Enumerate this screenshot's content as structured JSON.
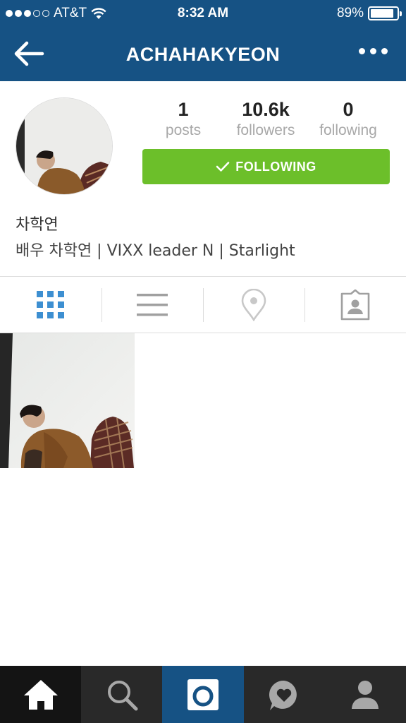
{
  "status_bar": {
    "carrier": "AT&T",
    "time": "8:32 AM",
    "battery": "89%",
    "battery_level": 0.89,
    "signal_dots_filled": 3,
    "signal_dots_total": 5
  },
  "nav": {
    "title": "ACHAHAKYEON",
    "back_icon": "arrow-left-icon",
    "more_icon": "more-dots-icon"
  },
  "profile": {
    "stats": [
      {
        "value": "1",
        "label": "posts"
      },
      {
        "value": "10.6k",
        "label": "followers"
      },
      {
        "value": "0",
        "label": "following"
      }
    ],
    "follow_button": "FOLLOWING",
    "name": "차학연",
    "bio": "배우 차학연 | VIXX leader N | Starlight"
  },
  "tabs": [
    {
      "icon": "grid-icon",
      "active": true
    },
    {
      "icon": "list-icon",
      "active": false
    },
    {
      "icon": "location-pin-icon",
      "active": false
    },
    {
      "icon": "tagged-photos-icon",
      "active": false
    }
  ],
  "posts_count": 1,
  "bottom_nav": [
    {
      "icon": "home-icon",
      "active": true
    },
    {
      "icon": "search-icon",
      "active": false
    },
    {
      "icon": "camera-icon",
      "active": false
    },
    {
      "icon": "activity-heart-icon",
      "active": false
    },
    {
      "icon": "profile-icon",
      "active": false
    }
  ],
  "colors": {
    "header": "#165284",
    "follow_button": "#6cbf2a",
    "active_tab": "#3d8fd1",
    "inactive_tab": "#a0a0a0",
    "bottom_bar": "#292929"
  }
}
